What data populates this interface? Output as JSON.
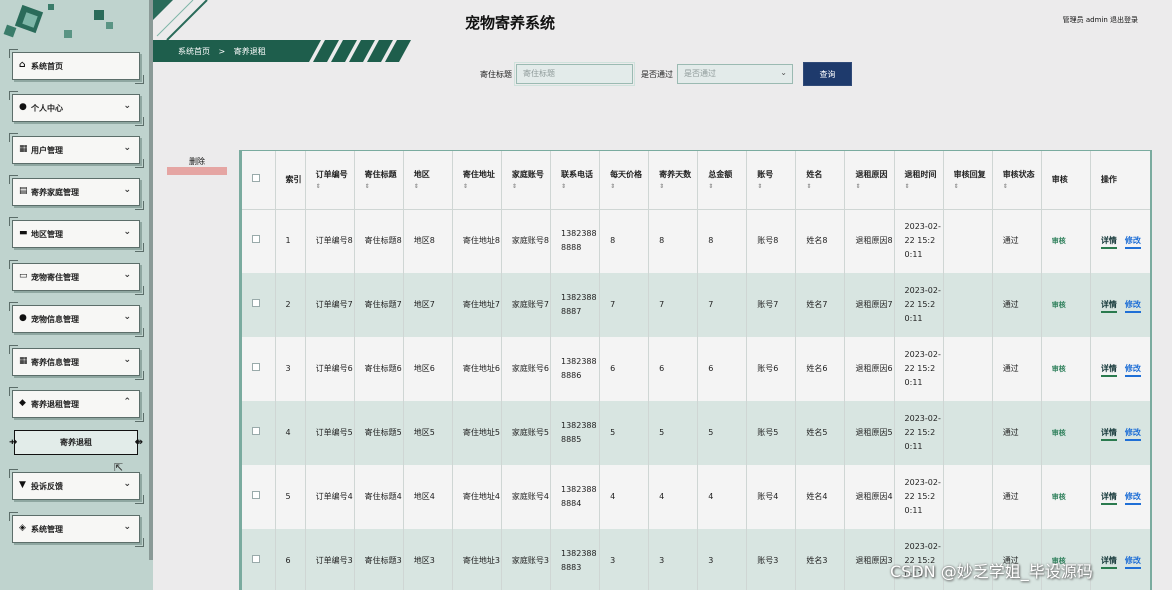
{
  "app": {
    "title": "宠物寄养系统",
    "admin_text": "管理员 admin  退出登录"
  },
  "breadcrumb": {
    "home": "系统首页",
    "sep": ">",
    "current": "寄养退租"
  },
  "search": {
    "title_label": "寄住标题",
    "title_placeholder": "寄住标题",
    "pass_label": "是否通过",
    "pass_placeholder": "是否通过",
    "query_label": "查询"
  },
  "delete_label": "删除",
  "sidebar": {
    "items": [
      {
        "label": "系统首页",
        "icon": "home-icon",
        "glyph": "⌂",
        "chevron": ""
      },
      {
        "label": "个人中心",
        "icon": "person-icon",
        "glyph": "●",
        "chevron": "⌄"
      },
      {
        "label": "用户管理",
        "icon": "grid-icon",
        "glyph": "▦",
        "chevron": "⌄"
      },
      {
        "label": "寄养家庭管理",
        "icon": "clipboard-icon",
        "glyph": "▤",
        "chevron": "⌄"
      },
      {
        "label": "地区管理",
        "icon": "card-icon",
        "glyph": "▬",
        "chevron": "⌄"
      },
      {
        "label": "宠物寄住管理",
        "icon": "monitor-icon",
        "glyph": "▭",
        "chevron": "⌄"
      },
      {
        "label": "宠物信息管理",
        "icon": "person-icon",
        "glyph": "●",
        "chevron": "⌄"
      },
      {
        "label": "寄养信息管理",
        "icon": "grid-icon",
        "glyph": "▦",
        "chevron": "⌄"
      },
      {
        "label": "寄养退租管理",
        "icon": "pin-icon",
        "glyph": "◆",
        "chevron": "⌃"
      },
      {
        "label": "投诉反馈",
        "icon": "feedback-icon",
        "glyph": "▼",
        "chevron": "⌄"
      },
      {
        "label": "系统管理",
        "icon": "gear-icon",
        "glyph": "◈",
        "chevron": "⌄"
      }
    ],
    "sub_item": "寄养退租"
  },
  "table": {
    "headers": [
      "索引",
      "订单编号",
      "寄住标题",
      "地区",
      "寄住地址",
      "家庭账号",
      "联系电话",
      "每天价格",
      "寄养天数",
      "总金额",
      "账号",
      "姓名",
      "退租原因",
      "退租时间",
      "审核回复",
      "审核状态",
      "审核",
      "操作"
    ],
    "rows": [
      {
        "idx": "1",
        "order": "订单编号8",
        "title": "寄住标题8",
        "area": "地区8",
        "addr": "寄住地址8",
        "family": "家庭账号8",
        "phone": "13823888888",
        "price": "8",
        "days": "8",
        "total": "8",
        "account": "账号8",
        "name": "姓名8",
        "reason": "退租原因8",
        "time": "2023-02-22 15:20:11",
        "reply": "",
        "status": "通过",
        "audit": "审核",
        "detail": "详情",
        "edit": "修改"
      },
      {
        "idx": "2",
        "order": "订单编号7",
        "title": "寄住标题7",
        "area": "地区7",
        "addr": "寄住地址7",
        "family": "家庭账号7",
        "phone": "13823888887",
        "price": "7",
        "days": "7",
        "total": "7",
        "account": "账号7",
        "name": "姓名7",
        "reason": "退租原因7",
        "time": "2023-02-22 15:20:11",
        "reply": "",
        "status": "通过",
        "audit": "审核",
        "detail": "详情",
        "edit": "修改"
      },
      {
        "idx": "3",
        "order": "订单编号6",
        "title": "寄住标题6",
        "area": "地区6",
        "addr": "寄住地址6",
        "family": "家庭账号6",
        "phone": "13823888886",
        "price": "6",
        "days": "6",
        "total": "6",
        "account": "账号6",
        "name": "姓名6",
        "reason": "退租原因6",
        "time": "2023-02-22 15:20:11",
        "reply": "",
        "status": "通过",
        "audit": "审核",
        "detail": "详情",
        "edit": "修改"
      },
      {
        "idx": "4",
        "order": "订单编号5",
        "title": "寄住标题5",
        "area": "地区5",
        "addr": "寄住地址5",
        "family": "家庭账号5",
        "phone": "13823888885",
        "price": "5",
        "days": "5",
        "total": "5",
        "account": "账号5",
        "name": "姓名5",
        "reason": "退租原因5",
        "time": "2023-02-22 15:20:11",
        "reply": "",
        "status": "通过",
        "audit": "审核",
        "detail": "详情",
        "edit": "修改"
      },
      {
        "idx": "5",
        "order": "订单编号4",
        "title": "寄住标题4",
        "area": "地区4",
        "addr": "寄住地址4",
        "family": "家庭账号4",
        "phone": "13823888884",
        "price": "4",
        "days": "4",
        "total": "4",
        "account": "账号4",
        "name": "姓名4",
        "reason": "退租原因4",
        "time": "2023-02-22 15:20:11",
        "reply": "",
        "status": "通过",
        "audit": "审核",
        "detail": "详情",
        "edit": "修改"
      },
      {
        "idx": "6",
        "order": "订单编号3",
        "title": "寄住标题3",
        "area": "地区3",
        "addr": "寄住地址3",
        "family": "家庭账号3",
        "phone": "13823888883",
        "price": "3",
        "days": "3",
        "total": "3",
        "account": "账号3",
        "name": "姓名3",
        "reason": "退租原因3",
        "time": "2023-02-22 15:20:11",
        "reply": "",
        "status": "通过",
        "audit": "审核",
        "detail": "详情",
        "edit": "修改"
      }
    ]
  },
  "watermark": "CSDN @妙乏学姐_毕设源码"
}
